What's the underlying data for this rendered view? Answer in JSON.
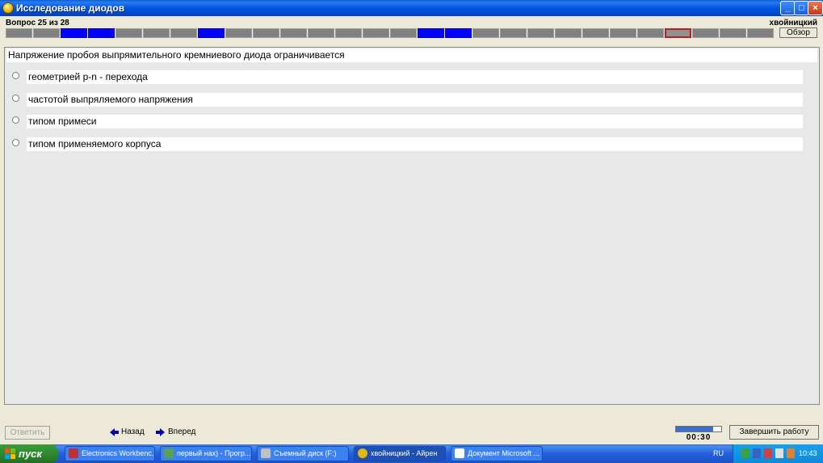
{
  "window": {
    "title": "Исследование диодов",
    "btn_minimize": "_",
    "btn_maximize": "□",
    "btn_close": "×"
  },
  "header": {
    "question_counter": "Вопрос 25 из 28",
    "user_name": "хвойницкий",
    "browse_label": "Обзор"
  },
  "progress": {
    "total": 28,
    "answered": [
      3,
      4,
      8,
      16,
      17
    ],
    "current": 25
  },
  "question": {
    "text": "Напряжение пробоя выпрямительного кремниевого диода ограничивается",
    "options": [
      "геометрией p-n - перехода",
      "частотой выпряляемого напряжения",
      "типом примеси",
      "типом применяемого корпуса"
    ]
  },
  "controls": {
    "answer_label": "Ответить",
    "back_label": "Назад",
    "forward_label": "Вперед",
    "timer_text": "00:30",
    "timer_fraction": 0.82,
    "finish_label": "Завершить работу"
  },
  "taskbar": {
    "start_label": "пуск",
    "items": [
      "Electronics Workbenc...",
      "первый нах) - Прогр...",
      "Съемный диск (F:)",
      "хвойницкий - Айрен",
      "Документ Microsoft ..."
    ],
    "language": "RU",
    "clock": "10:43"
  },
  "colors": {
    "answered_cell": "#0000ff",
    "current_cell_border": "#b22222",
    "pending_cell": "#808080"
  }
}
